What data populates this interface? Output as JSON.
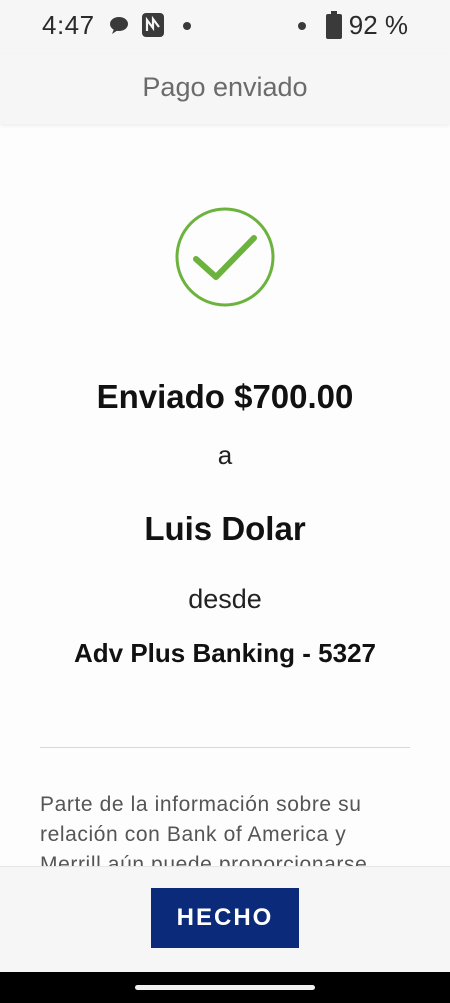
{
  "status_bar": {
    "time": "4:47",
    "battery": "92 %",
    "icons": [
      "message-icon",
      "app-notification-icon",
      "dot-icon",
      "dot-icon",
      "battery-icon"
    ]
  },
  "header": {
    "title": "Pago enviado"
  },
  "confirmation": {
    "amount_text": "Enviado $700.00",
    "to_word": "a",
    "recipient": "Luis Dolar",
    "from_word": "desde",
    "account": "Adv Plus Banking - 5327",
    "check_color": "#6cb33e"
  },
  "disclaimer": {
    "text": "Parte de la información sobre su relación con Bank of America y Merrill aún puede proporcionarse"
  },
  "footer": {
    "done_label": "HECHO",
    "button_color": "#0b2a7a"
  }
}
